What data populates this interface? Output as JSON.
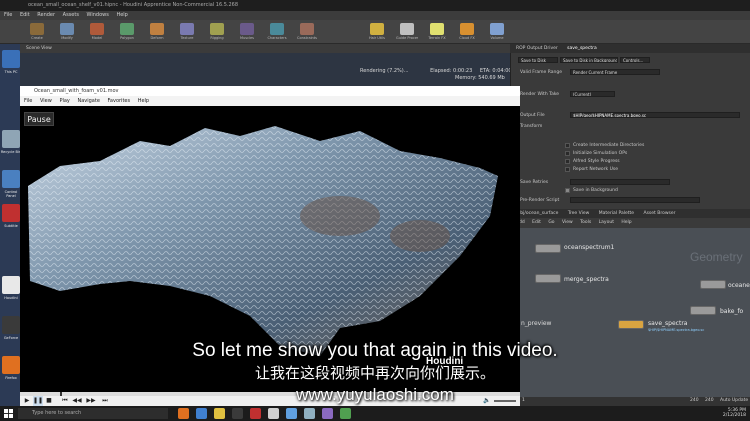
{
  "houdini": {
    "title": "ocean_small_ocean_shelf_v01.hipnc - Houdini Apprentice Non-Commercial 16.5.268",
    "menu": [
      "File",
      "Edit",
      "Render",
      "Assets",
      "Windows",
      "Help"
    ],
    "shelf_labels": [
      "Create",
      "Modify",
      "Model",
      "Polygon",
      "Deform",
      "Texture",
      "Rigging",
      "Muscles",
      "Characters",
      "Constraints",
      "Hair Utils",
      "Guide Process",
      "Terrain FX",
      "Cloud FX",
      "Volume"
    ],
    "viewport_tab": "Scene View",
    "render_status": "Rendering (7.2%)...",
    "elapsed": "Elapsed: 0:00:23",
    "eta": "ETA: 0:04:00",
    "memory": "Memory: 540.69 Mb",
    "param_node_label": "ROP Output Driver",
    "param_node_name": "save_spectra",
    "param_tabs": [
      "Save to Disk",
      "Save to Disk in Background",
      "Controls..."
    ],
    "params": [
      {
        "label": "Valid Frame Range",
        "value": "Render Current Frame"
      },
      {
        "label": "Render With Take",
        "value": "(Current)"
      },
      {
        "label": "Output File",
        "value": "$HIP/geo/$HIPNAME.spectra.bgeo.sc"
      },
      {
        "label": "Transform",
        "value": ""
      }
    ],
    "checks": [
      "Create Intermediate Directories",
      "Initialize Simulation OPs",
      "Alfred Style Progress",
      "Report Network Use"
    ],
    "save_bg": "Save in Background",
    "save_retries": "Save Retries",
    "pre_render": "Pre-Render Script",
    "net_tabs": [
      "/obj/ocean_surface",
      "Tree View",
      "Material Palette",
      "Asset Browser"
    ],
    "net_tools": [
      "Add",
      "Edit",
      "Go",
      "View",
      "Tools",
      "Layout",
      "Help"
    ],
    "net_context": "Geometry",
    "nodes": [
      {
        "name": "oceanspectrum1"
      },
      {
        "name": "merge_spectra"
      },
      {
        "name": "save_spectra",
        "sub": "$HIP/$HIPNAME.spectra.bgeo.sc"
      },
      {
        "name": "bake_fo"
      },
      {
        "name": "oceanev"
      }
    ],
    "n_preview": "n_preview",
    "frame_start": "1",
    "frame_end": "240",
    "frame_cur": "240",
    "auto_update": "Auto Update"
  },
  "desktop": {
    "icons": [
      "This PC",
      "Recycle Bin",
      "Control Panel",
      "Subtitle",
      "Houdini",
      "GeForce",
      "Firefox"
    ]
  },
  "player": {
    "title": "Ocean_small_with_foam_v01.mov",
    "menu": [
      "File",
      "View",
      "Play",
      "Navigate",
      "Favorites",
      "Help"
    ],
    "pause_label": "Pause"
  },
  "subtitles": {
    "en": "So let me show you that again in this video.",
    "zh": "让我在这段视频中再次向你们展示。",
    "watermark": "www.yuyulaoshi.com",
    "logo": "Houdini"
  },
  "taskbar": {
    "search_placeholder": "Type here to search",
    "time": "5:36 PM",
    "date": "2/12/2018"
  },
  "colors": {
    "houdini_bg": "#3a3a3a",
    "player_bg": "#000000",
    "taskbar": "#1c1c1c",
    "node_orange": "#d9a441",
    "node_gray": "#9a9a9a"
  }
}
